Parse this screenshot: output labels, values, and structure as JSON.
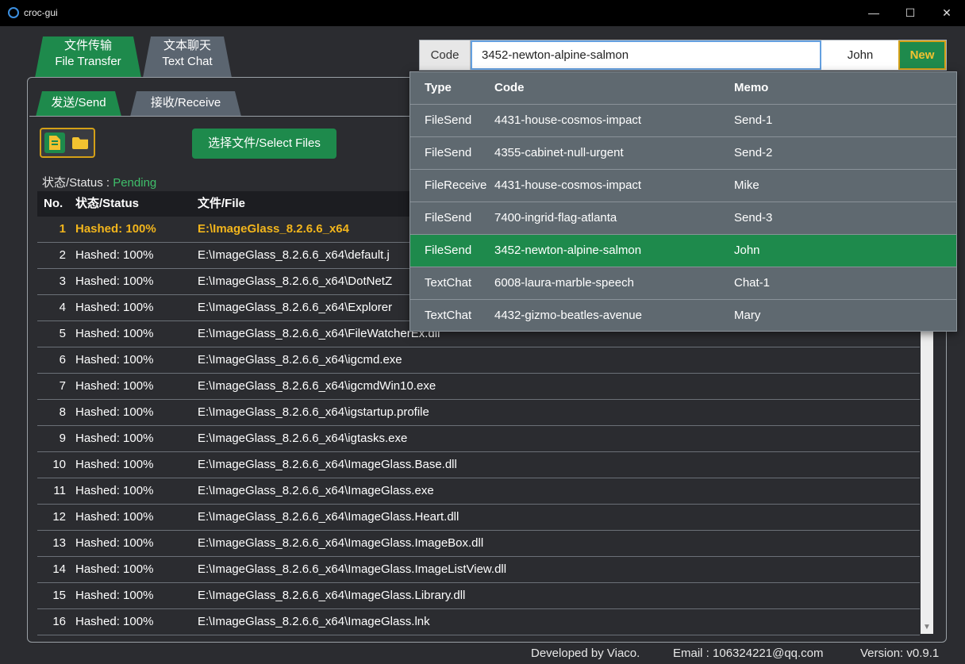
{
  "window": {
    "title": "croc-gui",
    "minimize": "—",
    "maximize": "☐",
    "close": "✕"
  },
  "top_tabs": [
    {
      "line1": "文件传输",
      "line2": "File Transfer"
    },
    {
      "line1": "文本聊天",
      "line2": "Text Chat"
    }
  ],
  "sub_tabs": [
    "发送/Send",
    "接收/Receive"
  ],
  "select_files_label": "选择文件/Select Files",
  "status": {
    "label": "状态/Status :",
    "value": "Pending"
  },
  "table": {
    "headers": {
      "no": "No.",
      "status": "状态/Status",
      "file": "文件/File"
    },
    "rows": [
      {
        "no": "1",
        "status": "Hashed: 100%",
        "file": "E:\\ImageGlass_8.2.6.6_x64"
      },
      {
        "no": "2",
        "status": "Hashed: 100%",
        "file": "E:\\ImageGlass_8.2.6.6_x64\\default.j"
      },
      {
        "no": "3",
        "status": "Hashed: 100%",
        "file": "E:\\ImageGlass_8.2.6.6_x64\\DotNetZ"
      },
      {
        "no": "4",
        "status": "Hashed: 100%",
        "file": "E:\\ImageGlass_8.2.6.6_x64\\Explorer"
      },
      {
        "no": "5",
        "status": "Hashed: 100%",
        "file": "E:\\ImageGlass_8.2.6.6_x64\\FileWatcherEx.dll"
      },
      {
        "no": "6",
        "status": "Hashed: 100%",
        "file": "E:\\ImageGlass_8.2.6.6_x64\\igcmd.exe"
      },
      {
        "no": "7",
        "status": "Hashed: 100%",
        "file": "E:\\ImageGlass_8.2.6.6_x64\\igcmdWin10.exe"
      },
      {
        "no": "8",
        "status": "Hashed: 100%",
        "file": "E:\\ImageGlass_8.2.6.6_x64\\igstartup.profile"
      },
      {
        "no": "9",
        "status": "Hashed: 100%",
        "file": "E:\\ImageGlass_8.2.6.6_x64\\igtasks.exe"
      },
      {
        "no": "10",
        "status": "Hashed: 100%",
        "file": "E:\\ImageGlass_8.2.6.6_x64\\ImageGlass.Base.dll"
      },
      {
        "no": "11",
        "status": "Hashed: 100%",
        "file": "E:\\ImageGlass_8.2.6.6_x64\\ImageGlass.exe"
      },
      {
        "no": "12",
        "status": "Hashed: 100%",
        "file": "E:\\ImageGlass_8.2.6.6_x64\\ImageGlass.Heart.dll"
      },
      {
        "no": "13",
        "status": "Hashed: 100%",
        "file": "E:\\ImageGlass_8.2.6.6_x64\\ImageGlass.ImageBox.dll"
      },
      {
        "no": "14",
        "status": "Hashed: 100%",
        "file": "E:\\ImageGlass_8.2.6.6_x64\\ImageGlass.ImageListView.dll"
      },
      {
        "no": "15",
        "status": "Hashed: 100%",
        "file": "E:\\ImageGlass_8.2.6.6_x64\\ImageGlass.Library.dll"
      },
      {
        "no": "16",
        "status": "Hashed: 100%",
        "file": "E:\\ImageGlass_8.2.6.6_x64\\ImageGlass.lnk"
      }
    ]
  },
  "code_bar": {
    "label": "Code",
    "code_value": "3452-newton-alpine-salmon",
    "memo_value": "John",
    "new_label": "New"
  },
  "dropdown": {
    "headers": {
      "type": "Type",
      "code": "Code",
      "memo": "Memo"
    },
    "items": [
      {
        "type": "FileSend",
        "code": "4431-house-cosmos-impact",
        "memo": "Send-1"
      },
      {
        "type": "FileSend",
        "code": "4355-cabinet-null-urgent",
        "memo": "Send-2"
      },
      {
        "type": "FileReceive",
        "code": "4431-house-cosmos-impact",
        "memo": "Mike"
      },
      {
        "type": "FileSend",
        "code": "7400-ingrid-flag-atlanta",
        "memo": "Send-3"
      },
      {
        "type": "FileSend",
        "code": "3452-newton-alpine-salmon",
        "memo": "John"
      },
      {
        "type": "TextChat",
        "code": "6008-laura-marble-speech",
        "memo": "Chat-1"
      },
      {
        "type": "TextChat",
        "code": "4432-gizmo-beatles-avenue",
        "memo": "Mary"
      }
    ]
  },
  "footer": {
    "developer": "Developed by Viaco.",
    "email": "Email : 106324221@qq.com",
    "version": "Version: v0.9.1"
  },
  "scrollbar_arrow": "▼",
  "colors": {
    "accent_green": "#1e8a4c",
    "highlight_yellow": "#f2b51c",
    "status_pending": "#3fbf6a",
    "background": "#2b2c30"
  },
  "icons": [
    "app-logo-icon",
    "file-icon",
    "folder-icon"
  ]
}
